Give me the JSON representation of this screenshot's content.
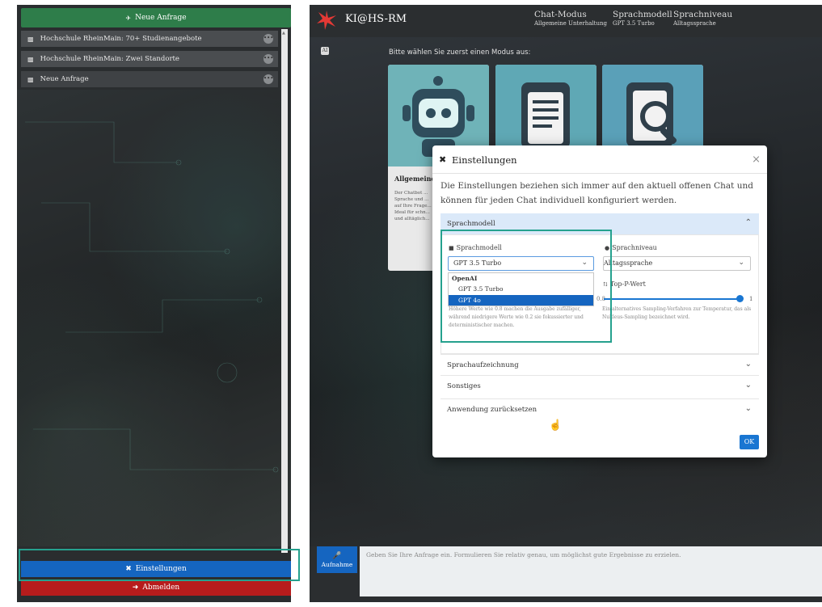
{
  "sidebar": {
    "new_chat_label": "Neue Anfrage",
    "chats": [
      {
        "title": "Hochschule RheinMain: 70+ Studienangebote"
      },
      {
        "title": "Hochschule RheinMain: Zwei Standorte"
      },
      {
        "title": "Neue Anfrage"
      }
    ],
    "settings_label": "Einstellungen",
    "logout_label": "Abmelden"
  },
  "header": {
    "app_title": "KI@HS-RM",
    "chat_mode_title": "Chat-Modus",
    "chat_mode_value": "Allgemeine Unterhaltung",
    "model_title": "Sprachmodell",
    "model_value": "GPT 3.5 Turbo",
    "level_title": "Sprachniveau",
    "level_value": "Alltagssprache"
  },
  "main": {
    "ai_badge": "AI",
    "mode_prompt": "Bitte wählen Sie zuerst einen Modus aus:",
    "card_general_title": "Allgemeine",
    "card_general_desc": "Der Chatbot ... Sprache und ... auf Ihre Frage... Ideal für schn... und alltäglich...",
    "input_placeholder": "Geben Sie Ihre Anfrage ein. Formulieren Sie relativ genau, um möglichst gute Ergebnisse zu erzielen.",
    "record_label": "Aufnahme"
  },
  "modal": {
    "title": "Einstellungen",
    "close_glyph": "×",
    "description": "Die Einstellungen beziehen sich immer auf den aktuell offenen Chat und können für jeden Chat individuell konfiguriert werden.",
    "section_sprachmodell": "Sprachmodell",
    "model_label": "Sprachmodell",
    "model_selected": "GPT 3.5 Turbo",
    "dropdown_group": "OpenAI",
    "dropdown_options": [
      "GPT 3.5 Turbo",
      "GPT 4o"
    ],
    "dropdown_highlighted": "GPT 4o",
    "temp_help": "Höhere Werte wie 0.8 machen die Ausgabe zufälliger, während niedrigere Werte wie 0.2 sie fokussierter und deterministischer machen.",
    "temp_hint": "0.8",
    "level_label": "Sprachniveau",
    "level_selected": "Alltagssprache",
    "topp_label": "Top-P-Wert",
    "topp_value": 1,
    "topp_value_text": "1",
    "topp_help": "Ein alternatives Sampling-Verfahren zur Temperatur, das als Nukleus-Sampling bezeichnet wird.",
    "section_aufzeichnung": "Sprachaufzeichnung",
    "section_sonstiges": "Sonstiges",
    "section_reset": "Anwendung zurücksetzen",
    "ok_label": "OK"
  },
  "colors": {
    "new_chat": "#2e7d4a",
    "settings": "#1565c0",
    "logout": "#b71c1c",
    "highlight": "#25a18e",
    "accordion_active": "#dbe9f9"
  }
}
